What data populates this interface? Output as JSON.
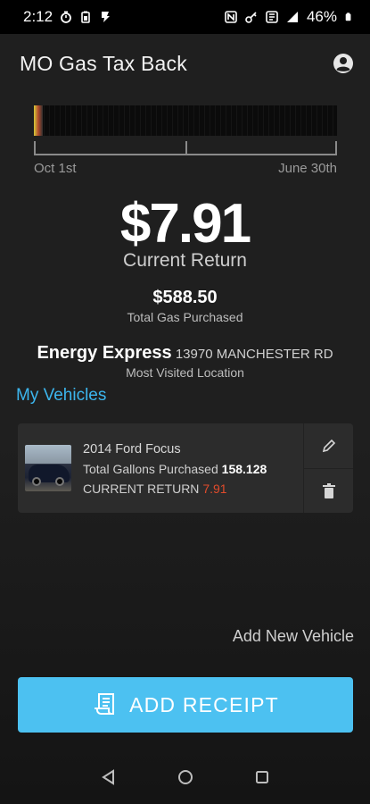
{
  "status_bar": {
    "time": "2:12",
    "battery": "46%"
  },
  "header": {
    "title": "MO Gas Tax Back"
  },
  "timeline": {
    "start_label": "Oct 1st",
    "end_label": "June 30th",
    "progress_fraction": 0.03
  },
  "summary": {
    "current_return_amount": "$7.91",
    "current_return_label": "Current Return",
    "total_gas_amount": "$588.50",
    "total_gas_label": "Total Gas Purchased",
    "location_name": "Energy Express",
    "location_address": "13970 MANCHESTER RD",
    "location_label": "Most Visited Location"
  },
  "vehicles": {
    "heading": "My Vehicles",
    "items": [
      {
        "name": "2014 Ford Focus",
        "gallons_label": "Total Gallons Purchased",
        "gallons_value": "158.128",
        "return_label": "CURRENT RETURN",
        "return_value": "7.91"
      }
    ],
    "add_label": "Add New Vehicle"
  },
  "actions": {
    "add_receipt_label": "ADD RECEIPT"
  },
  "icons": {
    "account": "account-circle-icon",
    "edit": "pencil-icon",
    "delete": "trash-icon",
    "receipt": "receipt-icon",
    "nav_back": "triangle-back-icon",
    "nav_home": "circle-home-icon",
    "nav_recents": "square-recents-icon"
  },
  "colors": {
    "accent": "#3cb6ee",
    "button": "#4cc1f1",
    "return_value": "#e04b2b",
    "background": "#1f1f1f"
  }
}
